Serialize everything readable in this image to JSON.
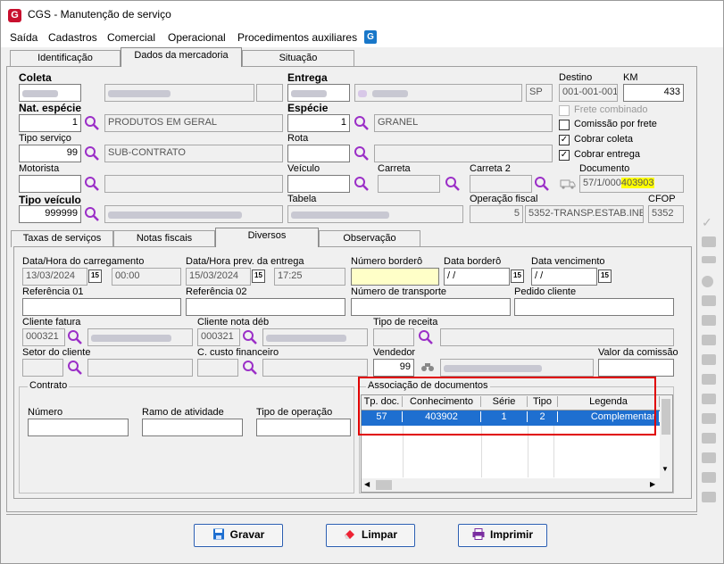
{
  "window": {
    "title": "CGS - Manutenção de serviço",
    "logo_letter": "G"
  },
  "menu": [
    "Saída",
    "Cadastros",
    "Comercial",
    "Operacional",
    "Procedimentos auxiliares"
  ],
  "top_tabs": [
    "Identificação",
    "Dados da mercadoria",
    "Situação"
  ],
  "header": {
    "coleta_label": "Coleta",
    "entrega_label": "Entrega",
    "entrega_uf": "SP",
    "destino_label": "Destino",
    "destino_value": "001-001-001",
    "km_label": "KM",
    "km_value": "433",
    "nat_especie_label": "Nat. espécie",
    "nat_especie_code": "1",
    "nat_especie_desc": "PRODUTOS EM GERAL",
    "especie_label": "Espécie",
    "especie_code": "1",
    "especie_desc": "GRANEL",
    "tipo_servico_label": "Tipo serviço",
    "tipo_servico_code": "99",
    "tipo_servico_desc": "SUB-CONTRATO",
    "rota_label": "Rota",
    "motorista_label": "Motorista",
    "veiculo_label": "Veículo",
    "carreta_label": "Carreta",
    "carreta2_label": "Carreta 2",
    "documento_label": "Documento",
    "documento_prefix": "57/1/000",
    "documento_number": "403903",
    "tipo_veiculo_label": "Tipo veículo",
    "tipo_veiculo_code": "999999",
    "tabela_label": "Tabela",
    "operacao_fiscal_label": "Operação fiscal",
    "operacao_fiscal_code": "5",
    "operacao_fiscal_desc": "5352-TRANSP.ESTAB.INE",
    "cfop_label": "CFOP",
    "cfop_value": "5352",
    "checks": [
      {
        "label": "Frete combinado",
        "checked": false,
        "disabled": true
      },
      {
        "label": "Comissão por frete",
        "checked": false,
        "disabled": false
      },
      {
        "label": "Cobrar coleta",
        "checked": true,
        "disabled": false
      },
      {
        "label": "Cobrar entrega",
        "checked": true,
        "disabled": false
      }
    ]
  },
  "sub_tabs": [
    "Taxas de serviços",
    "Notas fiscais",
    "Diversos",
    "Observação"
  ],
  "diversos": {
    "dt_carregamento_label": "Data/Hora do carregamento",
    "dt_carregamento_date": "13/03/2024",
    "dt_carregamento_time": "00:00",
    "dt_prev_entrega_label": "Data/Hora prev. da entrega",
    "dt_prev_entrega_date": "15/03/2024",
    "dt_prev_entrega_time": "17:25",
    "numero_bordero_label": "Número borderô",
    "data_bordero_label": "Data borderô",
    "data_bordero_value": " / /",
    "data_vencimento_label": "Data vencimento",
    "data_vencimento_value": " / /",
    "cal_glyph": "15",
    "referencia01_label": "Referência 01",
    "referencia02_label": "Referência 02",
    "numero_transporte_label": "Número de transporte",
    "pedido_cliente_label": "Pedido cliente",
    "cliente_fatura_label": "Cliente fatura",
    "cliente_fatura_code": "000321",
    "cliente_nota_label": "Cliente nota déb",
    "cliente_nota_code": "000321",
    "tipo_receita_label": "Tipo de receita",
    "setor_cliente_label": "Setor do cliente",
    "custo_financeiro_label": "C. custo financeiro",
    "vendedor_label": "Vendedor",
    "vendedor_code": "99",
    "valor_comissao_label": "Valor da comissão"
  },
  "contrato": {
    "title": "Contrato",
    "numero_label": "Número",
    "ramo_label": "Ramo de atividade",
    "tipo_operacao_label": "Tipo de operação"
  },
  "associacao": {
    "title": "Associação de documentos",
    "columns": [
      "Tp. doc.",
      "Conhecimento",
      "Série",
      "Tipo",
      "Legenda"
    ],
    "rows": [
      [
        "57",
        "403902",
        "1",
        "2",
        "Complementar"
      ]
    ]
  },
  "buttons": {
    "gravar": "Gravar",
    "limpar": "Limpar",
    "imprimir": "Imprimir"
  }
}
